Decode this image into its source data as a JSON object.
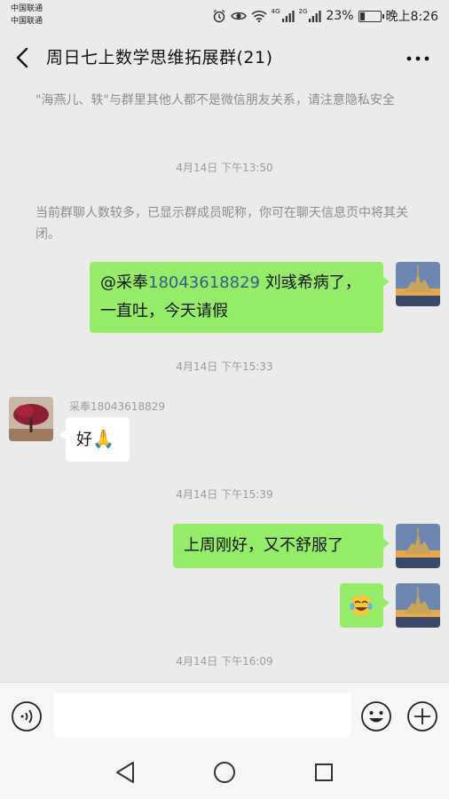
{
  "status_bar": {
    "carrier1": "中国联通",
    "carrier2": "中国联通",
    "net1": "4G",
    "net2": "2G",
    "battery": "23%",
    "battery_level": 0.23,
    "time": "晚上8:26",
    "icons": [
      "alarm-icon",
      "eye-icon",
      "wifi-icon",
      "signal-icon",
      "battery-icon"
    ]
  },
  "header": {
    "title": "周日七上数学思维拓展群(21)",
    "back_icon": "back-chevron-icon",
    "more_icon": "more-dots-icon"
  },
  "messages": {
    "system1": "\"海燕儿、轶\"与群里其他人都不是微信朋友关系，请注意隐私安全",
    "time1": "4月14日  下午13:50",
    "system2": "当前群聊人数较多，已显示群成员昵称，你可在聊天信息页中将其关闭。",
    "msg1_mention": "@采奉",
    "msg1_number": "18043618829",
    "msg1_line1_rest": " 刘彧希病了，",
    "msg1_line2": "一直吐，今天请假",
    "time2": "4月14日  下午15:33",
    "sender2": "采奉18043618829",
    "msg2_text": "好",
    "msg2_emoji": "🙏",
    "time3": "4月14日  下午15:39",
    "msg3": "上周刚好，又不舒服了",
    "msg4_emoji": "crying-laughing-emoji",
    "time4": "4月14日  下午16:09"
  },
  "input_bar": {
    "voice_icon": "voice-icon",
    "input_value": "",
    "emoji_icon": "emoji-icon",
    "plus_icon": "plus-icon"
  },
  "nav_bar": {
    "icons": [
      "back-triangle-icon",
      "home-circle-icon",
      "recents-square-icon"
    ]
  },
  "colors": {
    "bubble_me": "#95ec69",
    "bubble_them": "#ffffff",
    "background": "#ebebeb",
    "mention_number": "#3a5a8c"
  }
}
